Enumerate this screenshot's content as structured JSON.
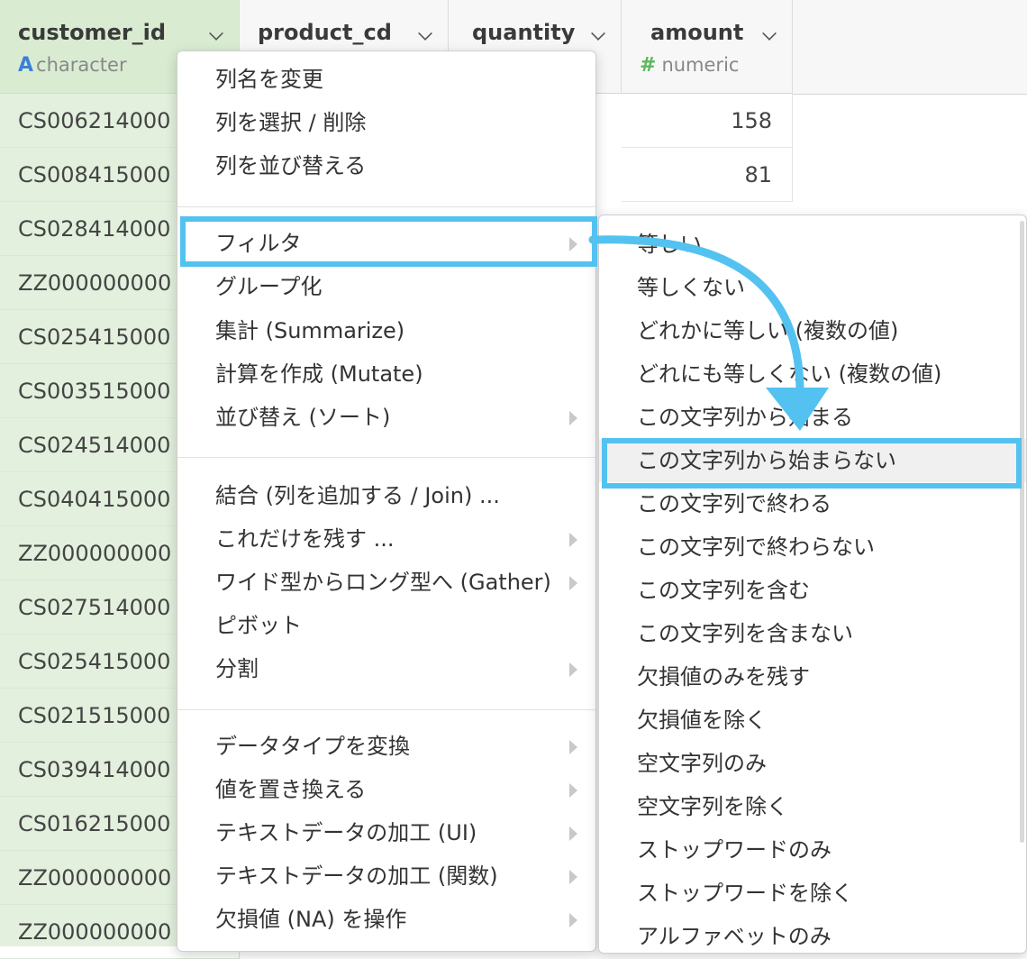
{
  "columns": [
    {
      "name": "customer_id",
      "type": "character"
    },
    {
      "name": "product_cd",
      "type": ""
    },
    {
      "name": "quantity",
      "type": ""
    },
    {
      "name": "amount",
      "type": "numeric"
    }
  ],
  "customer_ids": [
    "CS006214000",
    "CS008415000",
    "CS028414000",
    "ZZ000000000",
    "CS025415000",
    "CS003515000",
    "CS024514000",
    "CS040415000",
    "ZZ000000000",
    "CS027514000",
    "CS025415000",
    "CS021515000",
    "CS039414000",
    "CS016215000",
    "ZZ000000000",
    "ZZ000000000"
  ],
  "amounts": [
    "158",
    "81"
  ],
  "column_menu": {
    "group1": [
      "列名を変更",
      "列を選択 / 削除",
      "列を並び替える"
    ],
    "group2": [
      "フィルタ",
      "グループ化",
      "集計 (Summarize)",
      "計算を作成 (Mutate)",
      "並び替え (ソート)"
    ],
    "group3": [
      "結合 (列を追加する / Join) ...",
      "これだけを残す ...",
      "ワイド型からロング型へ (Gather)",
      "ピボット",
      "分割"
    ],
    "group4": [
      "データタイプを変換",
      "値を置き換える",
      "テキストデータの加工 (UI)",
      "テキストデータの加工 (関数)",
      "欠損値 (NA) を操作"
    ]
  },
  "filter_submenu": [
    "等しい",
    "等しくない",
    "どれかに等しい (複数の値)",
    "どれにも等しくない (複数の値)",
    "この文字列から始まる",
    "この文字列から始まらない",
    "この文字列で終わる",
    "この文字列で終わらない",
    "この文字列を含む",
    "この文字列を含まない",
    "欠損値のみを残す",
    "欠損値を除く",
    "空文字列のみ",
    "空文字列を除く",
    "ストップワードのみ",
    "ストップワードを除く",
    "アルファベットのみ"
  ],
  "colors": {
    "highlight": "#53c2f0",
    "customer_col_bg": "#e2f0dd",
    "type_character": "#3d7fd6",
    "type_numeric": "#5cb85c"
  }
}
